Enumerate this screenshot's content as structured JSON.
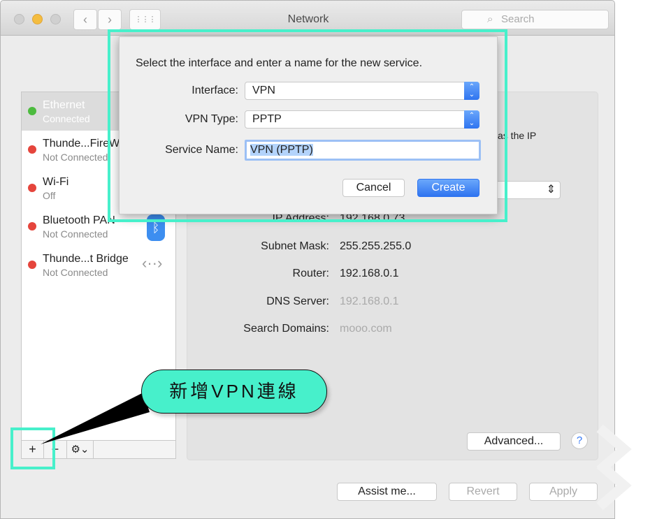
{
  "window": {
    "title": "Network",
    "search_placeholder": "Search"
  },
  "toolbar": {
    "back": "‹",
    "forward": "›",
    "grid": "⋮⋮⋮"
  },
  "services": [
    {
      "name": "Ethernet",
      "status": "Connected",
      "status_color": "#4cbb3e",
      "selected": true
    },
    {
      "name": "Thunde...FireWire",
      "status": "Not Connected",
      "status_color": "#e5453c"
    },
    {
      "name": "Wi-Fi",
      "status": "Off",
      "status_color": "#e5453c"
    },
    {
      "name": "Bluetooth PAN",
      "status": "Not Connected",
      "status_color": "#e5453c"
    },
    {
      "name": "Thunde...t Bridge",
      "status": "Not Connected",
      "status_color": "#e5453c"
    }
  ],
  "sidebar_buttons": {
    "add": "+",
    "remove": "−",
    "gear": "⚙⌄"
  },
  "details": {
    "partial_text": "as the IP",
    "rows": [
      {
        "label": "IP Address:",
        "value": "192.168.0.73"
      },
      {
        "label": "Subnet Mask:",
        "value": "255.255.255.0"
      },
      {
        "label": "Router:",
        "value": "192.168.0.1"
      },
      {
        "label": "DNS Server:",
        "value": "192.168.0.1"
      },
      {
        "label": "Search Domains:",
        "value": "mooo.com"
      }
    ],
    "advanced": "Advanced...",
    "help": "?"
  },
  "footer": {
    "assist": "Assist me...",
    "revert": "Revert",
    "apply": "Apply"
  },
  "dialog": {
    "prompt": "Select the interface and enter a name for the new service.",
    "interface_label": "Interface:",
    "interface_value": "VPN",
    "vpn_type_label": "VPN Type:",
    "vpn_type_value": "PPTP",
    "service_name_label": "Service Name:",
    "service_name_value": "VPN (PPTP)",
    "cancel": "Cancel",
    "create": "Create"
  },
  "annotation": {
    "callout": "新增VPN連線",
    "highlight_color": "#47f0cb"
  }
}
